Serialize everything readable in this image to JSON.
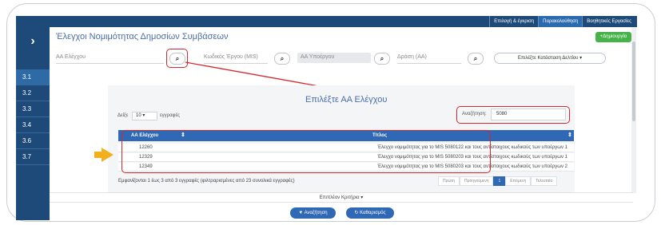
{
  "app": {
    "title": "Έλεγχοι Νομιμότητας Δημοσίων Συμβάσεων",
    "new_button": "+Δημιουργία",
    "top_nav": [
      "Επιλογή & έγκριση",
      "Παρακολούθηση",
      "Βοηθητικές Εργασίες"
    ]
  },
  "sidebar": {
    "toggle": "›",
    "items": [
      "3.1",
      "3.2",
      "3.3",
      "3.4",
      "3.6",
      "3.7"
    ]
  },
  "filters": {
    "aa_elegxou_label": "ΑΑ Ελέγχου",
    "kodikos_ergou_label": "Κωδικός Έργου (MIS)",
    "aa_ypoergou_label": "ΑΑ Υποέργου",
    "drasi_label": "Δράση (ΑΑ)",
    "status_select": "Επιλέξτε Κατάσταση Δελτίου ▾",
    "search_icon": "🔍"
  },
  "modal": {
    "title": "Επιλέξτε ΑΑ Ελέγχου",
    "show_label": "Δείξε",
    "page_length": "10",
    "records_label": "εγγραφές",
    "search_label": "Αναζήτηση:",
    "search_value": "5080",
    "columns": [
      "ΑΑ Ελέγχου",
      "Τίτλος"
    ],
    "rows": [
      {
        "code": "12260",
        "title": "Έλεγχο νομιμότητας για το MIS 5080122 και τους αντίστοιχους κωδικούς των υποέργων 1"
      },
      {
        "code": "12329",
        "title": "Έλεγχο νομιμότητας για το MIS 5080203 και τους αντίστοιχους κωδικούς των υποέργων 1"
      },
      {
        "code": "12349",
        "title": "Έλεγχο νομιμότητας για το MIS 5080203 και τους αντίστοιχους κωδικούς των υποέργων 2"
      }
    ],
    "info": "Εμφανίζονται 1 έως 3 από 3 εγγραφές (φιλτραρισμένες από 23 συνολικά εγγραφές)",
    "pager": [
      "Πρώτη",
      "Προηγούμενη",
      "1",
      "Επόμενη",
      "Τελευταία"
    ]
  },
  "more_criteria": "Επιπλέον Κριτήρια ▾",
  "actions": {
    "search": "▼ Αναζήτηση",
    "clear": "↻ Καθαρισμός"
  },
  "colors": {
    "primary": "#2f68b4",
    "sidebar": "#1d4a78",
    "highlight": "#d6272e",
    "pointer": "#f2b01e"
  }
}
